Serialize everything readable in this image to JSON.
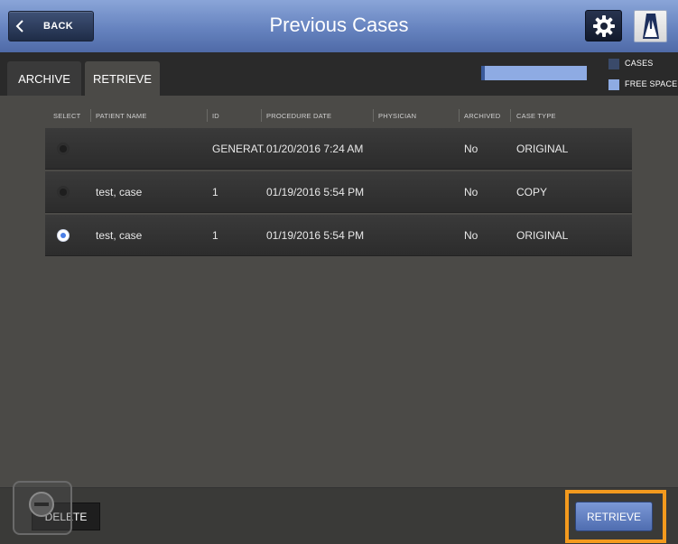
{
  "header": {
    "back_label": "BACK",
    "title": "Previous Cases"
  },
  "tabs": [
    {
      "label": "ARCHIVE",
      "active": false
    },
    {
      "label": "RETRIEVE",
      "active": true
    }
  ],
  "legend": {
    "cases_label": "CASES",
    "free_label": "FREE SPACE",
    "cases_color": "#3a4a6a",
    "free_color": "#8eabe3"
  },
  "table": {
    "columns": [
      "SELECT",
      "PATIENT NAME",
      "ID",
      "PROCEDURE DATE",
      "PHYSICIAN",
      "ARCHIVED",
      "CASE TYPE"
    ],
    "rows": [
      {
        "selected": false,
        "patient_name": "",
        "id": "GENERAT...",
        "procedure_date": "01/20/2016  7:24 AM",
        "physician": "",
        "archived": "No",
        "case_type": "ORIGINAL"
      },
      {
        "selected": false,
        "patient_name": "test, case",
        "id": "1",
        "procedure_date": "01/19/2016  5:54 PM",
        "physician": "",
        "archived": "No",
        "case_type": "COPY"
      },
      {
        "selected": true,
        "patient_name": "test, case",
        "id": "1",
        "procedure_date": "01/19/2016  5:54 PM",
        "physician": "",
        "archived": "No",
        "case_type": "ORIGINAL"
      }
    ]
  },
  "footer": {
    "delete_label": "DELETE",
    "retrieve_label": "RETRIEVE"
  },
  "colors": {
    "accent": "#6683bf",
    "highlight": "#f39a1e",
    "radio_selected": "#4a7ee6"
  },
  "icons": {
    "back": "chevron-left-icon",
    "settings": "gear-icon",
    "logo": "brand-logo-icon",
    "delete_badge": "minus-circle-icon"
  }
}
